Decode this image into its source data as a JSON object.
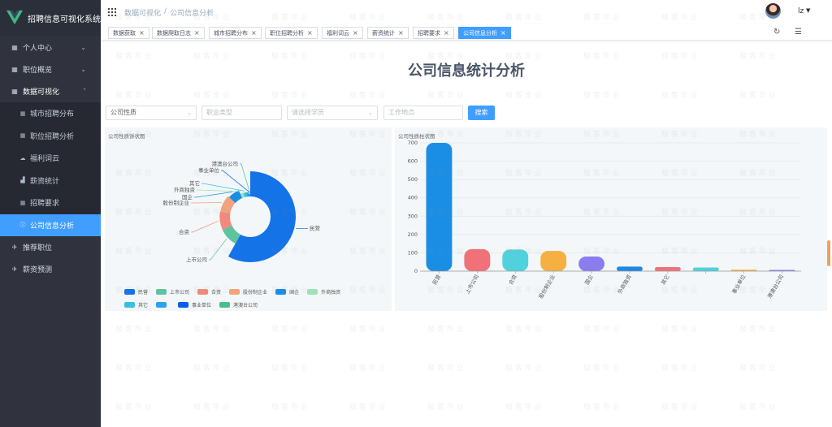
{
  "app": {
    "title": "招聘信息可视化系统"
  },
  "sidebar": {
    "items": [
      {
        "label": "个人中心",
        "icon": "dashboard-icon",
        "has_children": true
      },
      {
        "label": "职位概览",
        "icon": "dashboard-icon",
        "has_children": true
      },
      {
        "label": "数据可视化",
        "icon": "dashboard-icon",
        "has_children": true,
        "expanded": true,
        "children": [
          {
            "label": "城市招聘分布",
            "icon": "grid-icon"
          },
          {
            "label": "职位招聘分析",
            "icon": "grid-icon"
          },
          {
            "label": "福利词云",
            "icon": "cloud-icon"
          },
          {
            "label": "薪资统计",
            "icon": "bar-chart-icon"
          },
          {
            "label": "招聘要求",
            "icon": "grid-icon"
          },
          {
            "label": "公司信息分析",
            "icon": "info-icon",
            "active": true
          }
        ]
      },
      {
        "label": "推荐职位",
        "icon": "send-icon",
        "has_children": false
      },
      {
        "label": "薪资预测",
        "icon": "send-icon",
        "has_children": false
      }
    ]
  },
  "header": {
    "breadcrumb": [
      "数据可视化",
      "公司信息分析"
    ],
    "breadcrumb_sep": "/",
    "user_name": "lz"
  },
  "tags": [
    {
      "label": "数据获取",
      "active": false
    },
    {
      "label": "数据爬取日志",
      "active": false
    },
    {
      "label": "城市招聘分布",
      "active": false
    },
    {
      "label": "职位招聘分析",
      "active": false
    },
    {
      "label": "福利词云",
      "active": false
    },
    {
      "label": "薪资统计",
      "active": false
    },
    {
      "label": "招聘要求",
      "active": false
    },
    {
      "label": "公司信息分析",
      "active": true
    }
  ],
  "page": {
    "title": "公司信息统计分析"
  },
  "filters": {
    "company_type": {
      "value": "公司性质"
    },
    "job_type": {
      "placeholder": "职业类型"
    },
    "education": {
      "placeholder": "请选择学历"
    },
    "location": {
      "placeholder": "工作地点"
    },
    "search_label": "搜索"
  },
  "watermark_text": "极 客 毕 业",
  "colors": {
    "primary": "#409eff",
    "sidebar_bg": "#30333d",
    "series": [
      "#1473e6",
      "#5ec49e",
      "#f08a7f",
      "#f0a37e",
      "#1a8ee5",
      "#9de3b6",
      "#37c1e0",
      "#2aa3f0",
      "#0a5fe8",
      "#4ac08c"
    ]
  },
  "chart_data": [
    {
      "type": "pie",
      "title": "公司性质饼状图",
      "donut": true,
      "rose": true,
      "legend_placement": "bottom",
      "legend": [
        "民营",
        "上市公司",
        "合资",
        "股份制企业",
        "国企",
        "外商独资",
        "其它",
        "",
        "事业单位",
        "港澳台公司"
      ],
      "slices": [
        {
          "label": "民营",
          "value": 700
        },
        {
          "label": "上市公司",
          "value": 120
        },
        {
          "label": "合资",
          "value": 118
        },
        {
          "label": "股份制企业",
          "value": 110
        },
        {
          "label": "国企",
          "value": 80
        },
        {
          "label": "外商独资",
          "value": 25
        },
        {
          "label": "其它",
          "value": 22
        },
        {
          "label": "",
          "value": 20
        },
        {
          "label": "事业单位",
          "value": 8
        },
        {
          "label": "港澳台公司",
          "value": 3
        }
      ]
    },
    {
      "type": "bar",
      "title": "公司性质柱状图",
      "categories": [
        "民营",
        "上市公司",
        "合资",
        "股份制企业",
        "国企",
        "外商独资",
        "其它",
        "",
        "事业单位",
        "港澳台公司"
      ],
      "values": [
        700,
        120,
        118,
        110,
        80,
        25,
        22,
        20,
        8,
        3
      ],
      "ylim": [
        0,
        700
      ],
      "yticks": [
        0,
        100,
        200,
        300,
        400,
        500,
        600,
        700
      ],
      "grid": true,
      "xlabel": "",
      "ylabel": ""
    }
  ]
}
